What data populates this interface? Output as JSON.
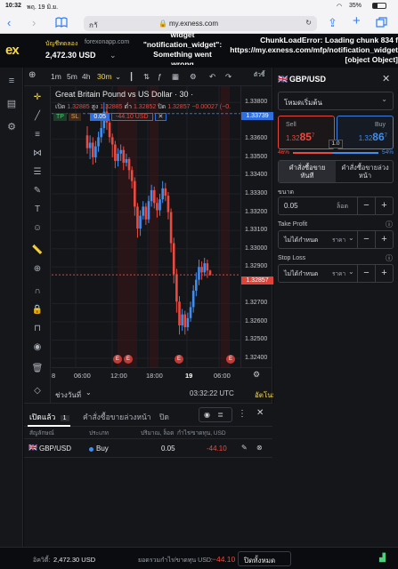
{
  "ios": {
    "time": "10:32",
    "date": "พฤ. 19 มิ.ย.",
    "battery": "35%"
  },
  "safari": {
    "url_prefix": "กาั",
    "url": "my.exness.com"
  },
  "header": {
    "logo": "ex",
    "account_type": "บัญชีทดลอง",
    "server": "forexonapp.com",
    "balance": "2,472.30 USD",
    "error_widget_1": "widget",
    "error_widget_2": "\"notification_widget\":",
    "error_widget_3": "Something went",
    "error_widget_4": "wrong",
    "error_right_1": "ChunkLoadError: Loading chunk 834 f",
    "error_right_2": "https://my.exness.com/mfp/notification_widget",
    "error_right_3": "[object Object]"
  },
  "chart": {
    "timeframes": [
      "1m",
      "5m",
      "4h",
      "30m"
    ],
    "active_timeframe": "30m",
    "indicators_label": "ตัวชี้",
    "title": "Great Britain Pound vs US Dollar · 30 ·",
    "ohlc": {
      "open_label": "เปิด",
      "open": "1.32885",
      "high_label": "สูง",
      "high": "1.32885",
      "low_label": "ต่ำ",
      "low": "1.32852",
      "close_label": "ปิด",
      "close": "1.32857",
      "change": "−0.00027 (−0."
    },
    "position_line": {
      "tp": "TP",
      "sl": "SL",
      "volume": "0.05",
      "pnl": "-44.10 USD"
    },
    "price_ticks": [
      "1.33800",
      "1.33600",
      "1.33500",
      "1.33400",
      "1.33300",
      "1.33200",
      "1.33100",
      "1.33000",
      "1.32900",
      "1.32700",
      "1.32600",
      "1.32500",
      "1.32400"
    ],
    "price_tag_top": "1.33739",
    "price_tag_current": "1.32857",
    "time_ticks": [
      "8",
      "06:00",
      "12:00",
      "18:00",
      "19",
      "06:00"
    ],
    "range_label": "ช่วงวันที่",
    "clock": "03:32:22 UTC",
    "auto_label": "อัตโนมัติ",
    "chart_data": {
      "type": "candlestick",
      "title": "Great Britain Pound vs US Dollar · 30",
      "ylim": [
        1.324,
        1.3385
      ],
      "current_price": 1.32857,
      "entry_price": 1.33739,
      "candles": [
        [
          1.3362,
          1.3355,
          1.3367,
          1.3352
        ],
        [
          1.3355,
          1.3358,
          1.3362,
          1.3349
        ],
        [
          1.3358,
          1.335,
          1.3361,
          1.3346
        ],
        [
          1.335,
          1.3356,
          1.3359,
          1.3347
        ],
        [
          1.3356,
          1.3361,
          1.3364,
          1.3353
        ],
        [
          1.3361,
          1.3366,
          1.3372,
          1.3358
        ],
        [
          1.3366,
          1.3375,
          1.338,
          1.3363
        ],
        [
          1.3375,
          1.3369,
          1.3379,
          1.3365
        ],
        [
          1.3369,
          1.3361,
          1.3371,
          1.3358
        ],
        [
          1.3361,
          1.3357,
          1.3363,
          1.335
        ],
        [
          1.3357,
          1.3348,
          1.3359,
          1.3344
        ],
        [
          1.3348,
          1.3352,
          1.3355,
          1.3345
        ],
        [
          1.3352,
          1.3354,
          1.3357,
          1.3348
        ],
        [
          1.3354,
          1.3347,
          1.3356,
          1.3343
        ],
        [
          1.3347,
          1.3349,
          1.3352,
          1.3345
        ],
        [
          1.3349,
          1.3343,
          1.335,
          1.3338
        ],
        [
          1.3343,
          1.3337,
          1.3345,
          1.3333
        ],
        [
          1.3337,
          1.3323,
          1.3339,
          1.3318
        ],
        [
          1.3323,
          1.3311,
          1.3325,
          1.3306
        ],
        [
          1.3311,
          1.3318,
          1.3321,
          1.3307
        ],
        [
          1.3318,
          1.3323,
          1.3326,
          1.3316
        ],
        [
          1.3323,
          1.3316,
          1.3325,
          1.3313
        ],
        [
          1.3316,
          1.3326,
          1.3329,
          1.3314
        ],
        [
          1.3326,
          1.3332,
          1.3335,
          1.3323
        ],
        [
          1.3332,
          1.3325,
          1.3334,
          1.3322
        ],
        [
          1.3325,
          1.3321,
          1.3328,
          1.3317
        ],
        [
          1.3321,
          1.3327,
          1.333,
          1.3318
        ],
        [
          1.3327,
          1.3333,
          1.3337,
          1.3325
        ],
        [
          1.3333,
          1.3329,
          1.3336,
          1.3326
        ],
        [
          1.3329,
          1.332,
          1.3331,
          1.3316
        ],
        [
          1.332,
          1.3303,
          1.3322,
          1.3298
        ],
        [
          1.3303,
          1.3286,
          1.3306,
          1.3281
        ],
        [
          1.3286,
          1.3271,
          1.3289,
          1.3265
        ],
        [
          1.3271,
          1.3258,
          1.3274,
          1.3253
        ],
        [
          1.3258,
          1.3264,
          1.3267,
          1.3255
        ],
        [
          1.3264,
          1.3257,
          1.3266,
          1.3253
        ],
        [
          1.3257,
          1.3262,
          1.3265,
          1.3255
        ],
        [
          1.3262,
          1.3268,
          1.3271,
          1.326
        ],
        [
          1.3268,
          1.3277,
          1.328,
          1.3265
        ],
        [
          1.3277,
          1.3283,
          1.3287,
          1.3274
        ],
        [
          1.3283,
          1.329,
          1.3294,
          1.328
        ],
        [
          1.329,
          1.3287,
          1.3293,
          1.3283
        ],
        [
          1.3287,
          1.3292,
          1.3295,
          1.3285
        ],
        [
          1.3292,
          1.3288,
          1.3294,
          1.3284
        ],
        [
          1.3288,
          1.32857,
          1.32885,
          1.32852
        ]
      ]
    }
  },
  "trade": {
    "symbol": "GBP/USD",
    "mode": "โหมดเริ่มต้น",
    "sell_label": "Sell",
    "sell_price_small": "1.32",
    "sell_price_big": "85",
    "sell_price_sup": "7",
    "buy_label": "Buy",
    "buy_price_small": "1.32",
    "buy_price_big": "86",
    "buy_price_sup": "7",
    "spread": "1.0",
    "sentiment_sell": "46%",
    "sentiment_buy": "54%",
    "sentiment_sell_fraction": 0.46,
    "order_market": "คำสั่งซื้อขายทันที",
    "order_pending": "คำสั่งซื้อขายล่วงหน้า",
    "volume_label": "ขนาด",
    "volume_value": "0.05",
    "volume_unit": "ล็อต",
    "tp_label": "Take Profit",
    "tp_value": "ไม่ได้กำหนด",
    "tp_unit": "ราคา",
    "sl_label": "Stop Loss",
    "sl_value": "ไม่ได้กำหนด",
    "sl_unit": "ราคา"
  },
  "positions": {
    "tab_open": "เปิดแล้ว",
    "tab_open_count": "1",
    "tab_pending": "คำสั่งซื้อขายล่วงหน้า",
    "tab_closed": "ปิด",
    "col_symbol": "สัญลักษณ์",
    "col_type": "ประเภท",
    "col_volume": "ปริมาณ, ล็อต",
    "col_pnl": "กำไร/ขาดทุน, USD",
    "rows": [
      {
        "symbol": "GBP/USD",
        "type": "Buy",
        "volume": "0.05",
        "pnl": "-44.10"
      }
    ]
  },
  "footer": {
    "equity_label": "อิควิตี้:",
    "equity_value": "2,472.30 USD",
    "pnl_label": "ยอดรวมกำไร/ขาดทุน USD:",
    "pnl_value": "−44.10",
    "close_all": "ปิดทั้งหมด"
  },
  "colors": {
    "bull": "#3f8ef0",
    "bear": "#ec4a3f",
    "accent": "#f6d84a",
    "buy_border": "#3f7fe0",
    "sell_border": "#e2463c"
  }
}
